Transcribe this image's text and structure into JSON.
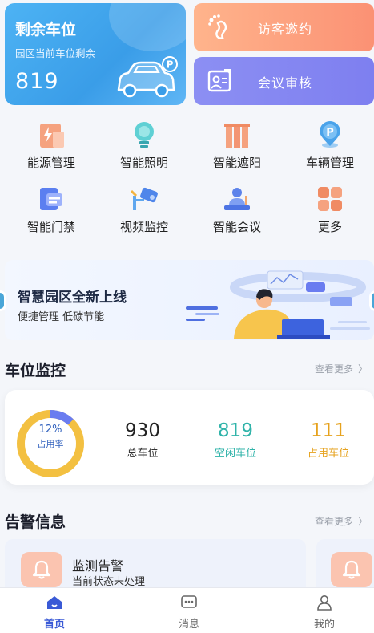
{
  "parking_card": {
    "title": "剩余车位",
    "subtitle": "园区当前车位剩余",
    "count": "819",
    "car_icon": "car-parking-icon"
  },
  "quick_actions": [
    {
      "label": "访客邀约",
      "icon": "footprint-icon"
    },
    {
      "label": "会议审核",
      "icon": "meeting-review-icon"
    }
  ],
  "function_grid": [
    {
      "label": "能源管理",
      "icon": "energy-icon"
    },
    {
      "label": "智能照明",
      "icon": "bulb-icon"
    },
    {
      "label": "智能遮阳",
      "icon": "blinds-icon"
    },
    {
      "label": "车辆管理",
      "icon": "parking-pin-icon"
    },
    {
      "label": "智能门禁",
      "icon": "access-card-icon"
    },
    {
      "label": "视频监控",
      "icon": "camera-icon"
    },
    {
      "label": "智能会议",
      "icon": "conference-icon"
    },
    {
      "label": "更多",
      "icon": "more-grid-icon"
    }
  ],
  "banner": {
    "title": "智慧园区全新上线",
    "subtitle": "便捷管理 低碳节能"
  },
  "parking_monitor": {
    "section_title": "车位监控",
    "see_more": "查看更多",
    "occupancy_percent": "12%",
    "occupancy_label": "占用率",
    "occupancy_fraction": 0.12,
    "stats": [
      {
        "value": "930",
        "label": "总车位",
        "color": "#222222"
      },
      {
        "value": "819",
        "label": "空闲车位",
        "color": "#2fb3a9"
      },
      {
        "value": "111",
        "label": "占用车位",
        "color": "#e6a21d"
      }
    ]
  },
  "alarm_info": {
    "section_title": "告警信息",
    "see_more": "查看更多",
    "cards": [
      {
        "title": "监测告警",
        "status": "当前状态未处理",
        "icon": "bell-icon"
      }
    ]
  },
  "tab_bar": [
    {
      "label": "首页",
      "icon": "home-icon",
      "active": true
    },
    {
      "label": "消息",
      "icon": "message-icon",
      "active": false
    },
    {
      "label": "我的",
      "icon": "user-icon",
      "active": false
    }
  ],
  "colors": {
    "accent_blue": "#3a5ad6",
    "parking_card": "#4db3f4",
    "visitor_card": "#fb9174",
    "meeting_card": "#8c8ff3",
    "donut_yellow": "#f3c041",
    "donut_blue": "#6a7cf0",
    "free_green": "#2fb3a9",
    "occupied_orange": "#e6a21d"
  }
}
